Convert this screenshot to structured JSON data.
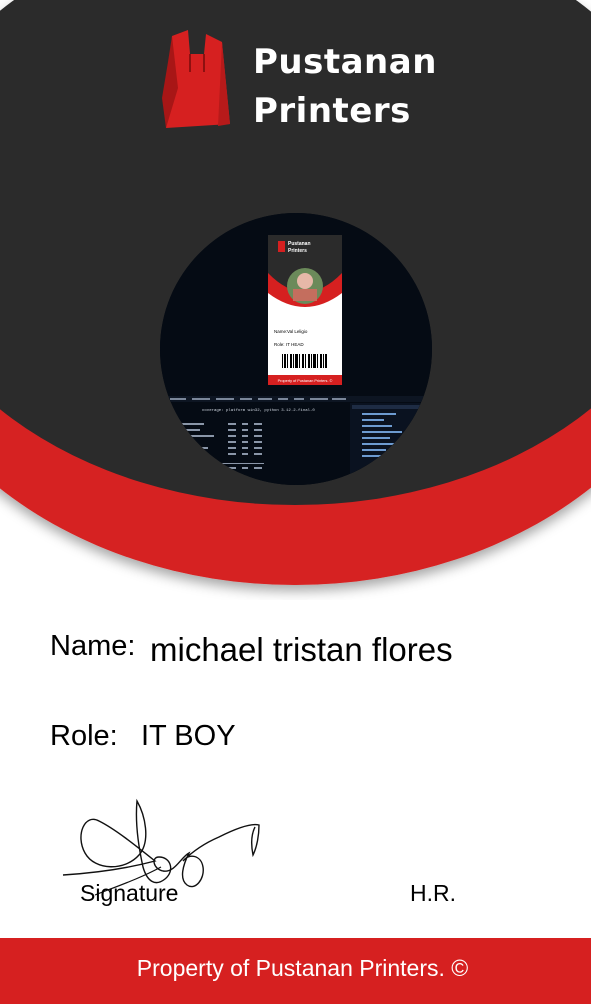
{
  "brand": {
    "line1": "Pustanan",
    "line2": "Printers",
    "logo_icon": "shopping-bag-icon"
  },
  "colors": {
    "dark_header": "#2b2b2b",
    "accent_red": "#d62020",
    "white": "#ffffff"
  },
  "photo": {
    "icon": "screenshot-photo",
    "mini_card": {
      "brand_line1": "Pustanan",
      "brand_line2": "Printers",
      "name_label": "Name:",
      "name_value": "Val Leligio",
      "role_label": "Role:",
      "role_value": "IT HEAD",
      "footer": "Property of Pustanan Printers. ©"
    },
    "terminal_line": "coverage: platform win32, python 3.12.2-final-0"
  },
  "fields": {
    "name_label": "Name:",
    "name_value": "michael tristan flores",
    "role_label": "Role:",
    "role_value": "IT BOY"
  },
  "signature": {
    "label": "Signature",
    "hr_label": "H.R.",
    "icon": "handwritten-signature"
  },
  "footer": {
    "text": "Property of Pustanan Printers. ©"
  }
}
